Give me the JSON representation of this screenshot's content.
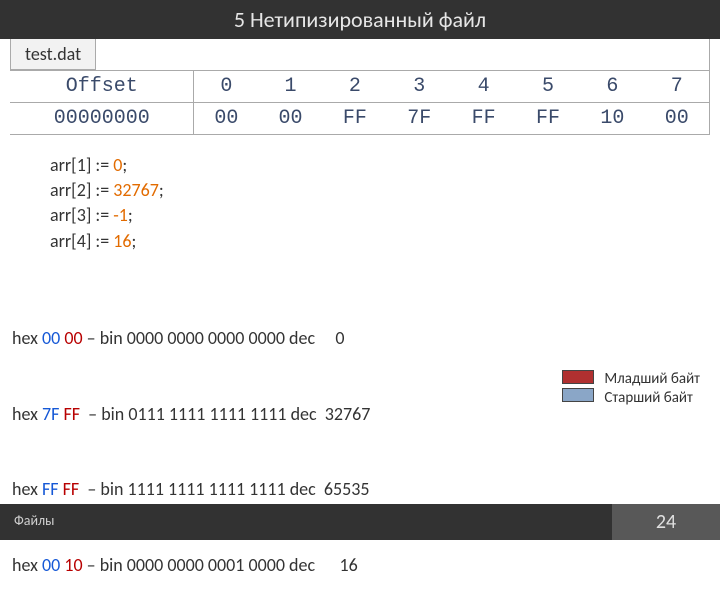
{
  "header": {
    "title": "5 Нетипизированный файл"
  },
  "file": {
    "name": "test.dat"
  },
  "hex": {
    "col_offset": "Offset",
    "cols": [
      "0",
      "1",
      "2",
      "3",
      "4",
      "5",
      "6",
      "7"
    ],
    "row_offset": "00000000",
    "bytes": [
      "00",
      "00",
      "FF",
      "7F",
      "FF",
      "FF",
      "10",
      "00"
    ]
  },
  "code": [
    {
      "pre": "arr[1] := ",
      "val": "0",
      "post": ";"
    },
    {
      "pre": "arr[2] := ",
      "val": "32767",
      "post": ";"
    },
    {
      "pre": "arr[3] := ",
      "val": "-1",
      "post": ";"
    },
    {
      "pre": "arr[4] := ",
      "val": "16",
      "post": ";"
    }
  ],
  "lines": [
    {
      "p": "hex ",
      "b1": "00",
      "sp": " ",
      "b2": "00",
      "rest": " – bin 0000 0000 0000 0000 dec     0"
    },
    {
      "p": "hex ",
      "b1": "7F",
      "sp": " ",
      "b2": "FF",
      "rest": "  – bin 0111 1111 1111 1111 dec  32767"
    },
    {
      "p": "hex ",
      "b1": "FF",
      "sp": " ",
      "b2": "FF",
      "rest": "  – bin 1111 1111 1111 1111 dec  65535"
    },
    {
      "p": "hex ",
      "b1": "00",
      "sp": " ",
      "b2": "10",
      "rest": " – bin 0000 0000 0001 0000 dec      16"
    }
  ],
  "legend": {
    "line1": "Младший байт",
    "line2": "Старший байт"
  },
  "footer": {
    "left": "Файлы",
    "page": "24"
  }
}
